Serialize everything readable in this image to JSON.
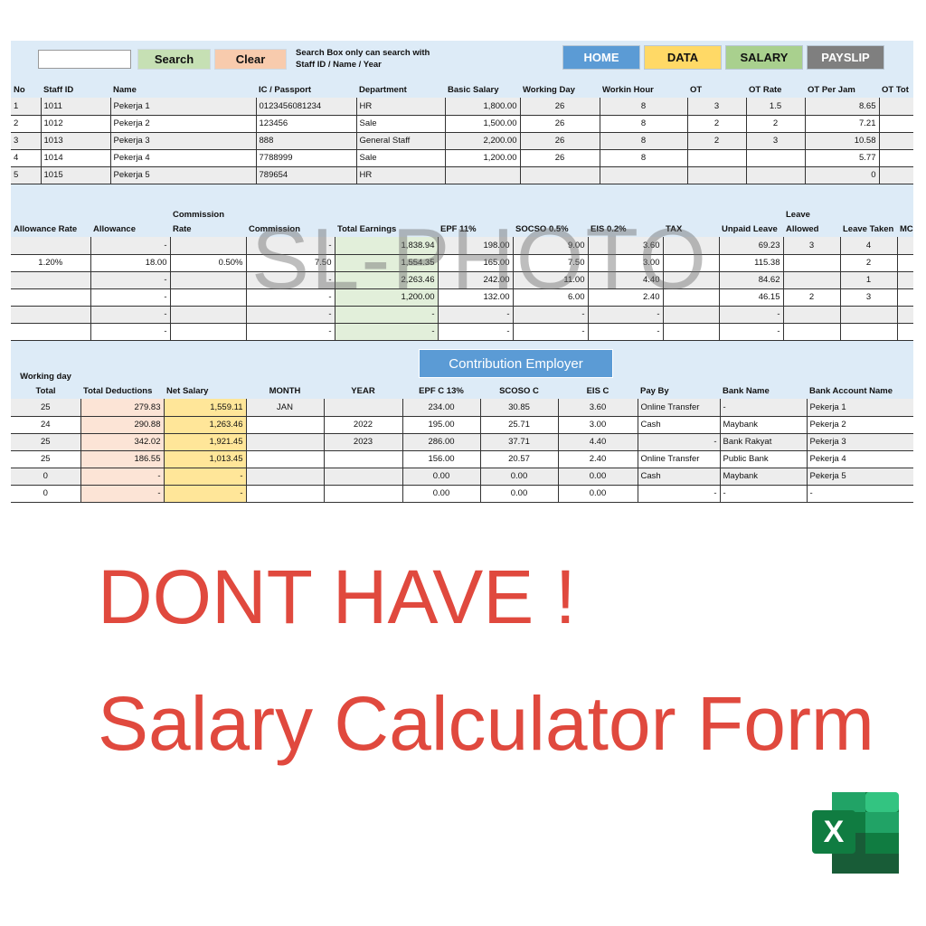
{
  "toolbar": {
    "search_placeholder": "",
    "search_label": "Search",
    "clear_label": "Clear",
    "note": "Search Box only can search with Staff ID / Name / Year",
    "nav": [
      {
        "label": "HOME",
        "bg": "#5b9bd5",
        "fg": "#ffffff"
      },
      {
        "label": "DATA",
        "bg": "#ffd966",
        "fg": "#111111"
      },
      {
        "label": "SALARY",
        "bg": "#a9d08e",
        "fg": "#111111"
      },
      {
        "label": "PAYSLIP",
        "bg": "#7f7f7f",
        "fg": "#ffffff"
      }
    ]
  },
  "table1": {
    "headers": [
      "No",
      "Staff ID",
      "Name",
      "IC / Passport",
      "Department",
      "Basic Salary",
      "Working Day",
      "Workin Hour",
      "OT",
      "OT Rate",
      "OT Per Jam",
      "OT Tot"
    ],
    "rows": [
      [
        "1",
        "1011",
        "Pekerja 1",
        "0123456081234",
        "HR",
        "1,800.00",
        "26",
        "8",
        "3",
        "1.5",
        "8.65",
        ""
      ],
      [
        "2",
        "1012",
        "Pekerja 2",
        "123456",
        "Sale",
        "1,500.00",
        "26",
        "8",
        "2",
        "2",
        "7.21",
        ""
      ],
      [
        "3",
        "1013",
        "Pekerja 3",
        "888",
        "General Staff",
        "2,200.00",
        "26",
        "8",
        "2",
        "3",
        "10.58",
        ""
      ],
      [
        "4",
        "1014",
        "Pekerja 4",
        "7788999",
        "Sale",
        "1,200.00",
        "26",
        "8",
        "",
        "",
        "5.77",
        ""
      ],
      [
        "5",
        "1015",
        "Pekerja 5",
        "789654",
        "HR",
        "",
        "",
        "",
        "",
        "",
        "0",
        ""
      ]
    ]
  },
  "table2": {
    "headers": [
      "Allowance Rate",
      "Allowance",
      "Commission Rate",
      "Commission",
      "Total Earnings",
      "EPF 11%",
      "SOCSO 0.5%",
      "EIS 0.2%",
      "TAX",
      "Unpaid Leave",
      "Leave Allowed",
      "Leave Taken",
      "MC"
    ],
    "rows": [
      [
        "",
        "-",
        "",
        "-",
        "1,838.94",
        "198.00",
        "9.00",
        "3.60",
        "",
        "69.23",
        "3",
        "4",
        ""
      ],
      [
        "1.20%",
        "18.00",
        "0.50%",
        "7.50",
        "1,554.35",
        "165.00",
        "7.50",
        "3.00",
        "",
        "115.38",
        "",
        "2",
        ""
      ],
      [
        "",
        "-",
        "",
        "-",
        "2,263.46",
        "242.00",
        "11.00",
        "4.40",
        "",
        "84.62",
        "",
        "1",
        ""
      ],
      [
        "",
        "-",
        "",
        "-",
        "1,200.00",
        "132.00",
        "6.00",
        "2.40",
        "",
        "46.15",
        "2",
        "3",
        ""
      ],
      [
        "",
        "-",
        "",
        "-",
        "-",
        "-",
        "-",
        "-",
        "",
        "-",
        "",
        "",
        ""
      ],
      [
        "",
        "-",
        "",
        "-",
        "-",
        "-",
        "-",
        "-",
        "",
        "-",
        "",
        "",
        ""
      ]
    ]
  },
  "contribution_label": "Contribution Employer",
  "table3": {
    "headers": [
      "Working day Total",
      "Total Deductions",
      "Net Salary",
      "MONTH",
      "YEAR",
      "EPF C 13%",
      "SCOSO C",
      "EIS C",
      "Pay By",
      "Bank Name",
      "Bank Account Name"
    ],
    "rows": [
      [
        "25",
        "279.83",
        "1,559.11",
        "JAN",
        "",
        "234.00",
        "30.85",
        "3.60",
        "Online Transfer",
        "-",
        "Pekerja 1"
      ],
      [
        "24",
        "290.88",
        "1,263.46",
        "",
        "2022",
        "195.00",
        "25.71",
        "3.00",
        "Cash",
        "Maybank",
        "Pekerja 2"
      ],
      [
        "25",
        "342.02",
        "1,921.45",
        "",
        "2023",
        "286.00",
        "37.71",
        "4.40",
        "-",
        "Bank Rakyat",
        "Pekerja 3"
      ],
      [
        "25",
        "186.55",
        "1,013.45",
        "",
        "",
        "156.00",
        "20.57",
        "2.40",
        "Online Transfer",
        "Public Bank",
        "Pekerja 4"
      ],
      [
        "0",
        "-",
        "-",
        "",
        "",
        "0.00",
        "0.00",
        "0.00",
        "Cash",
        "Maybank",
        "Pekerja 5"
      ],
      [
        "0",
        "-",
        "-",
        "",
        "",
        "0.00",
        "0.00",
        "0.00",
        "-",
        "-",
        "-"
      ]
    ]
  },
  "watermark": "SL-PHOTO",
  "promo": {
    "line1": "DONT HAVE !",
    "line2": "Salary Calculator Form"
  },
  "accent": "#e0493e"
}
